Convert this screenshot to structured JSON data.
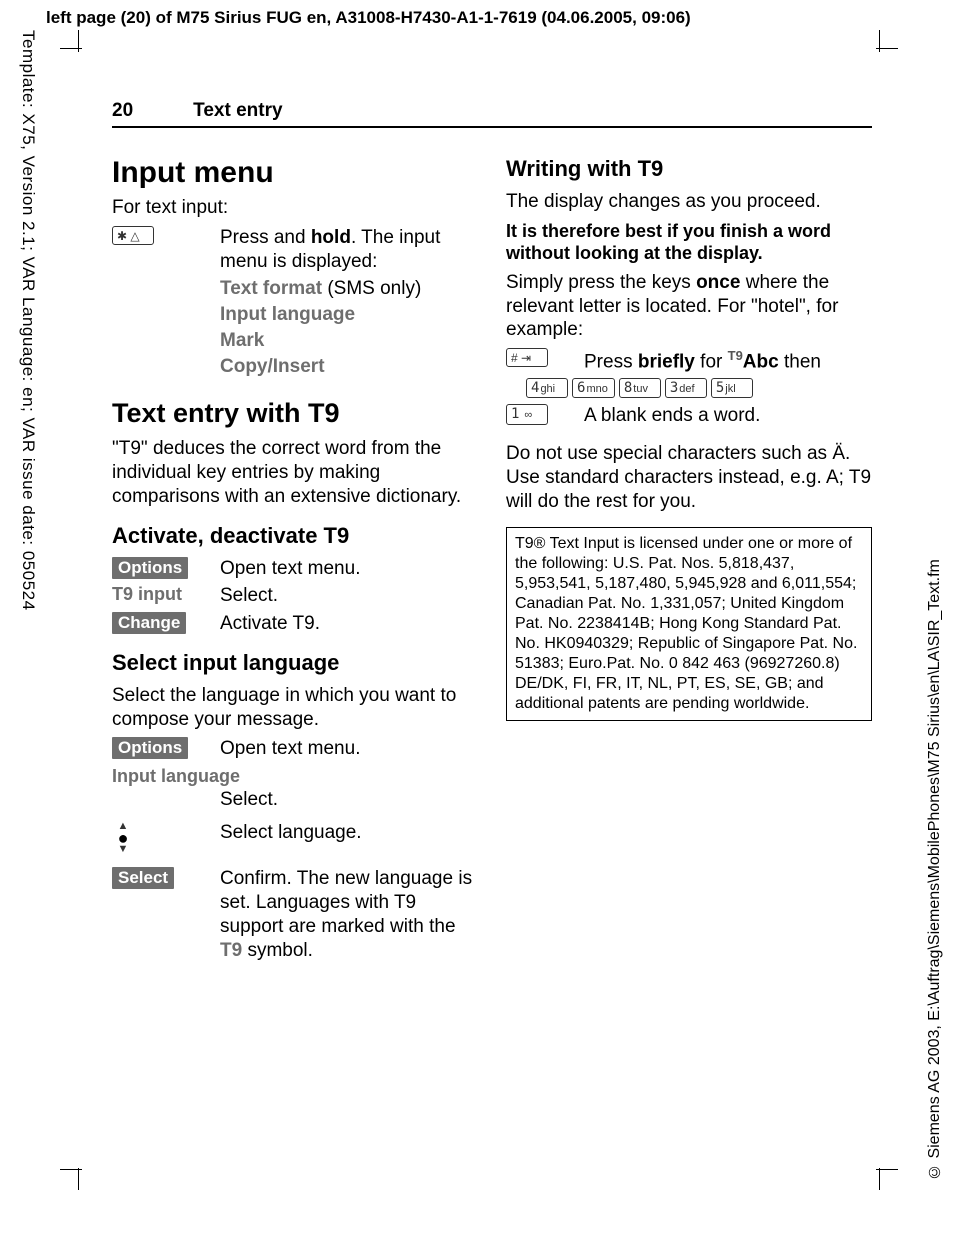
{
  "meta": {
    "top_header": "left page (20) of M75 Sirius FUG en, A31008-H7430-A1-1-7619 (04.06.2005, 09:06)",
    "template_note": "Template: X75, Version 2.1; VAR Language: en; VAR issue date: 050524",
    "copyright": "© Siemens AG 2003, E:\\Auftrag\\Siemens\\MobilePhones\\M75 Sirius\\en\\LA\\SIR_Text.fm"
  },
  "header": {
    "page_number": "20",
    "section": "Text entry"
  },
  "left": {
    "h1": "Input menu",
    "intro": "For text input:",
    "star_key": "✱ △",
    "press_hold_pre": "Press and ",
    "press_hold_bold": "hold",
    "press_hold_post": ". The input menu is displayed:",
    "menu_items": {
      "text_format": "Text format",
      "text_format_suffix": " (SMS only)",
      "input_language": "Input language",
      "mark": "Mark",
      "copy_insert": "Copy/Insert"
    },
    "h1b": "Text entry with T9",
    "t9_desc": "\"T9\" deduces the correct word from the individual key entries by making comparisons with an extensive dictionary.",
    "h2a": "Activate, deactivate T9",
    "rows_a": {
      "options": "Options",
      "options_txt": "Open text menu.",
      "t9input": "T9 input",
      "t9input_txt": "Select.",
      "change": "Change",
      "change_txt": "Activate T9."
    },
    "h2b": "Select input language",
    "sel_lang_desc": "Select the language in which you want to compose your message.",
    "rows_b": {
      "options": "Options",
      "options_txt": "Open text menu.",
      "input_language": "Input language",
      "select_txt": "Select.",
      "nav_txt": "Select language.",
      "select": "Select",
      "confirm_pre": "Confirm. The new language is set. Languages with T9 support are marked with the ",
      "t9_label": "T9",
      "confirm_post": " symbol."
    }
  },
  "right": {
    "h2": "Writing with T9",
    "desc1": "The display changes as you proceed.",
    "bold_note": "It is therefore best if you finish a word without looking at the display.",
    "desc2_pre": "Simply press the keys ",
    "desc2_bold": "once",
    "desc2_post": " where the relevant letter is located. For \"hotel\", for example:",
    "hash_key": "# ⇥",
    "press_briefly_pre": "Press ",
    "press_briefly_bold": "briefly",
    "press_briefly_mid": " for ",
    "press_briefly_mode": "T9Abc",
    "press_briefly_post": " then",
    "keys": [
      "4 ghi",
      "6 mno",
      "8 tuv",
      "3 def",
      "5 jkl"
    ],
    "one_key": "1 ∞",
    "blank_ends": "A blank ends a word.",
    "no_special": "Do not use special characters such as Ä. Use standard characters instead, e.g. A; T9 will do the rest for you.",
    "patents": "T9® Text Input is licensed under one or more of the following:\nU.S. Pat. Nos. 5,818,437, 5,953,541, 5,187,480, 5,945,928 and 6,011,554; Canadian Pat. No. 1,331,057;\nUnited Kingdom Pat. No. 2238414B;\nHong Kong Standard Pat. No. HK0940329; Republic of Singapore Pat. No. 51383; Euro.Pat. No. 0 842 463 (96927260.8) DE/DK, FI, FR, IT, NL, PT, ES, SE, GB;\nand additional patents are pending worldwide."
  }
}
